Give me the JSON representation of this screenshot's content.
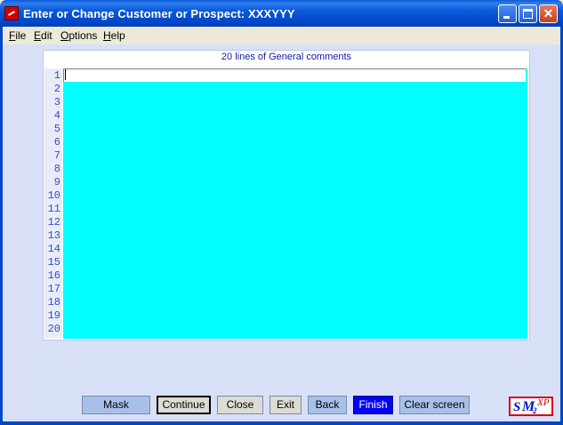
{
  "window": {
    "title": "Enter or Change Customer or Prospect:  XXXYYY",
    "controls": {
      "minimize": "minimize-icon",
      "maximize": "maximize-icon",
      "close": "close-icon"
    }
  },
  "menu": [
    {
      "label": "File",
      "hotkey": "F",
      "rest": "ile"
    },
    {
      "label": "Edit",
      "hotkey": "E",
      "rest": "dit"
    },
    {
      "label": "Options",
      "hotkey": "O",
      "rest": "ptions"
    },
    {
      "label": "Help",
      "hotkey": "H",
      "rest": "elp"
    }
  ],
  "comments": {
    "header": "20 lines of General comments",
    "line_numbers": [
      "1",
      "2",
      "3",
      "4",
      "5",
      "6",
      "7",
      "8",
      "9",
      "10",
      "11",
      "12",
      "13",
      "14",
      "15",
      "16",
      "17",
      "18",
      "19",
      "20"
    ],
    "lines": [
      "",
      "",
      "",
      "",
      "",
      "",
      "",
      "",
      "",
      "",
      "",
      "",
      "",
      "",
      "",
      "",
      "",
      "",
      "",
      ""
    ]
  },
  "buttons": {
    "mask": "Mask",
    "continue": "Continue",
    "close": "Close",
    "exit": "Exit",
    "back": "Back",
    "finish": "Finish",
    "clear": "Clear screen"
  },
  "logo": {
    "s": "S",
    "m": "M",
    "sub": "2",
    "sup": "XP"
  },
  "colors": {
    "titlebar": "#0a5ad8",
    "comment_area": "#00ffff",
    "finish_button": "#0000ff",
    "button": "#a8c0e8"
  }
}
